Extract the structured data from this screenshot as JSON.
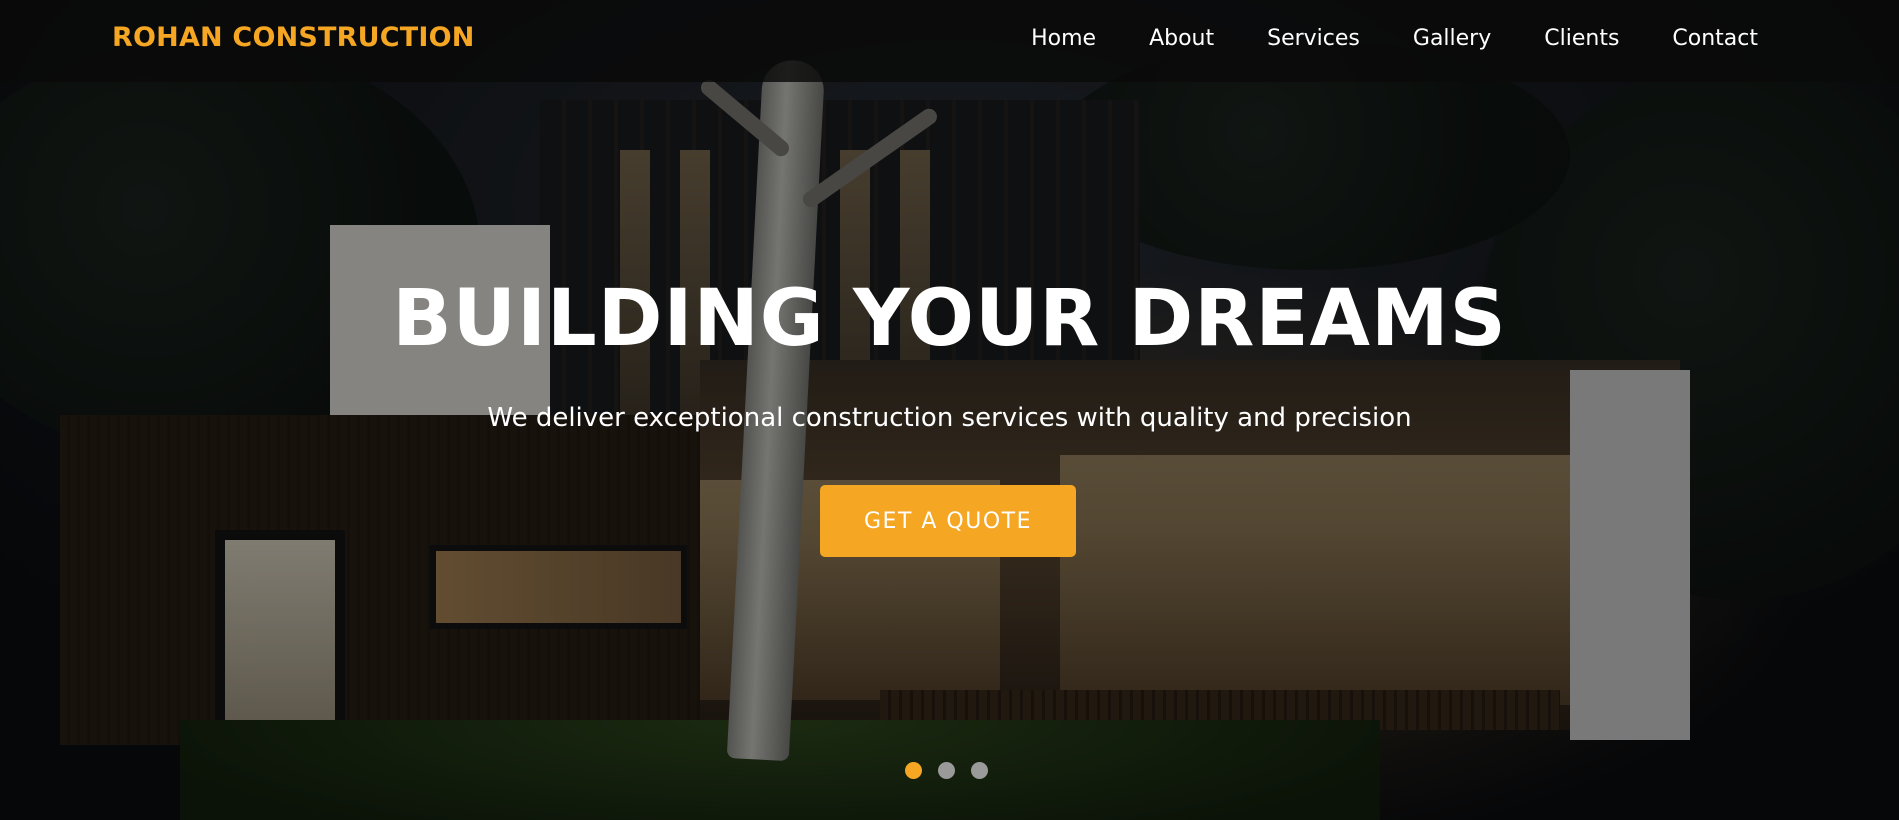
{
  "brand": {
    "name": "ROHAN CONSTRUCTION",
    "color": "#f5a623"
  },
  "nav": {
    "items": [
      {
        "label": "Home"
      },
      {
        "label": "About"
      },
      {
        "label": "Services"
      },
      {
        "label": "Gallery"
      },
      {
        "label": "Clients"
      },
      {
        "label": "Contact"
      }
    ]
  },
  "hero": {
    "title": "BUILDING YOUR DREAMS",
    "subtitle": "We deliver exceptional construction services with quality and precision",
    "cta_label": "GET A QUOTE",
    "background_image": "modern-house-at-dusk",
    "slides": {
      "count": 3,
      "active_index": 0,
      "active_color": "#f5a623",
      "inactive_color": "#9a9a9a"
    }
  },
  "colors": {
    "accent": "#f5a623",
    "navbar_bg": "#0a0a0a",
    "text": "#ffffff"
  }
}
